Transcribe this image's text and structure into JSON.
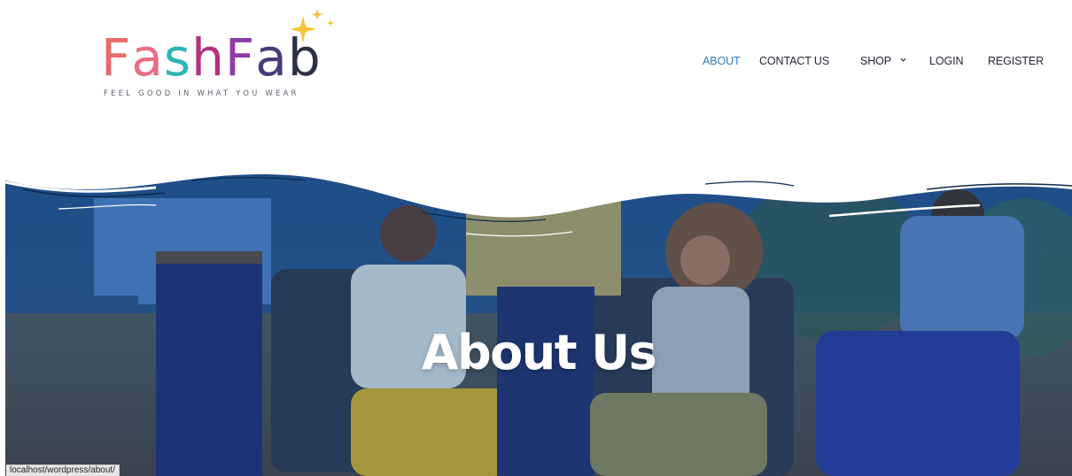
{
  "brand": {
    "logo_parts": [
      {
        "text": "F",
        "color": "#ea6a6a"
      },
      {
        "text": "a",
        "color": "#e96d86"
      },
      {
        "text": "s",
        "color": "#2bb5b3"
      },
      {
        "text": "h",
        "color": "#b3327e"
      },
      {
        "text": "F",
        "color": "#8e3aa8"
      },
      {
        "text": "a",
        "color": "#4a3a7a"
      },
      {
        "text": "b",
        "color": "#2d3147"
      }
    ],
    "tagline": "FEEL GOOD IN WHAT YOU WEAR",
    "sparkle_color": "#f5c23a"
  },
  "nav": {
    "items": [
      {
        "label": "ABOUT",
        "active": true
      },
      {
        "label": "CONTACT US"
      },
      {
        "label": "SHOP",
        "has_dropdown": true
      },
      {
        "label": "LOGIN"
      },
      {
        "label": "REGISTER"
      }
    ],
    "active_color": "#2e7ab8"
  },
  "hero": {
    "title": "About Us",
    "overlay_color": "#1d4a86"
  },
  "status_bar": {
    "url": "localhost/wordpress/about/"
  }
}
